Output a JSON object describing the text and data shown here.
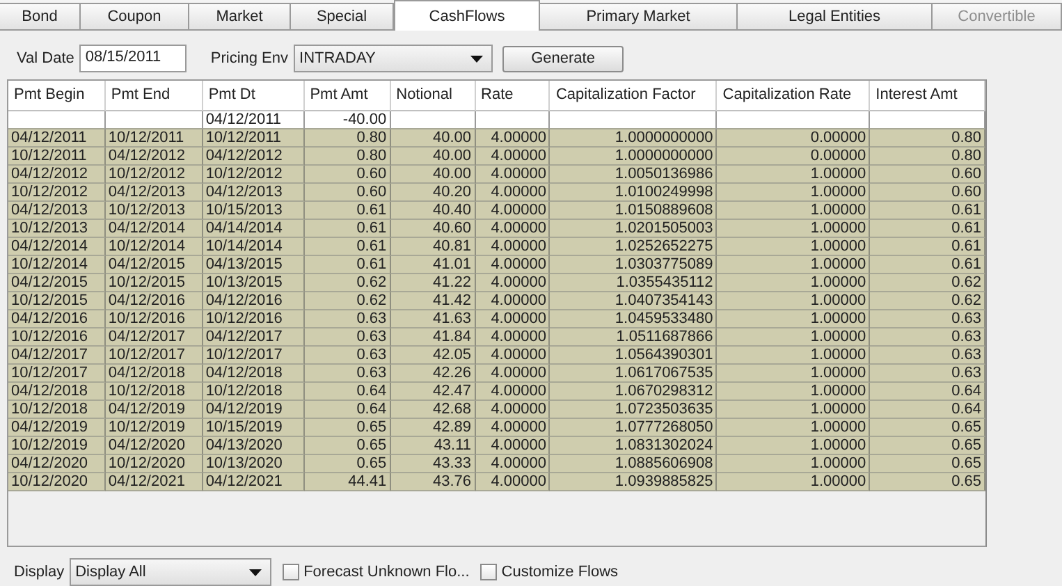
{
  "tabs": [
    {
      "label": "Bond",
      "selected": false,
      "disabled": false
    },
    {
      "label": "Coupon",
      "selected": false,
      "disabled": false
    },
    {
      "label": "Market",
      "selected": false,
      "disabled": false
    },
    {
      "label": "Special",
      "selected": false,
      "disabled": false
    },
    {
      "label": "CashFlows",
      "selected": true,
      "disabled": false
    },
    {
      "label": "Primary Market",
      "selected": false,
      "disabled": false
    },
    {
      "label": "Legal Entities",
      "selected": false,
      "disabled": false
    },
    {
      "label": "Convertible",
      "selected": false,
      "disabled": true
    }
  ],
  "toolbar": {
    "val_date": {
      "label": "Val Date",
      "value": "08/15/2011"
    },
    "pricing_env": {
      "label": "Pricing Env",
      "value": "INTRADAY"
    },
    "generate_button": "Generate"
  },
  "table": {
    "columns": [
      "Pmt Begin",
      "Pmt End",
      "Pmt Dt",
      "Pmt Amt",
      "Notional",
      "Rate",
      "Capitalization Factor",
      "Capitalization Rate",
      "Interest Amt"
    ],
    "rows": [
      {
        "kind": "initial",
        "cells": [
          null,
          null,
          "04/12/2011",
          "-40.00",
          null,
          null,
          null,
          null,
          null
        ]
      },
      {
        "kind": "flow",
        "cells": [
          "04/12/2011",
          "10/12/2011",
          "10/12/2011",
          "0.80",
          "40.00",
          "4.00000",
          "1.0000000000",
          "0.00000",
          "0.80"
        ]
      },
      {
        "kind": "flow",
        "cells": [
          "10/12/2011",
          "04/12/2012",
          "04/12/2012",
          "0.80",
          "40.00",
          "4.00000",
          "1.0000000000",
          "0.00000",
          "0.80"
        ]
      },
      {
        "kind": "flow",
        "cells": [
          "04/12/2012",
          "10/12/2012",
          "10/12/2012",
          "0.60",
          "40.00",
          "4.00000",
          "1.0050136986",
          "1.00000",
          "0.60"
        ]
      },
      {
        "kind": "flow",
        "cells": [
          "10/12/2012",
          "04/12/2013",
          "04/12/2013",
          "0.60",
          "40.20",
          "4.00000",
          "1.0100249998",
          "1.00000",
          "0.60"
        ]
      },
      {
        "kind": "flow",
        "cells": [
          "04/12/2013",
          "10/12/2013",
          "10/15/2013",
          "0.61",
          "40.40",
          "4.00000",
          "1.0150889608",
          "1.00000",
          "0.61"
        ]
      },
      {
        "kind": "flow",
        "cells": [
          "10/12/2013",
          "04/12/2014",
          "04/14/2014",
          "0.61",
          "40.60",
          "4.00000",
          "1.0201505003",
          "1.00000",
          "0.61"
        ]
      },
      {
        "kind": "flow",
        "cells": [
          "04/12/2014",
          "10/12/2014",
          "10/14/2014",
          "0.61",
          "40.81",
          "4.00000",
          "1.0252652275",
          "1.00000",
          "0.61"
        ]
      },
      {
        "kind": "flow",
        "cells": [
          "10/12/2014",
          "04/12/2015",
          "04/13/2015",
          "0.61",
          "41.01",
          "4.00000",
          "1.0303775089",
          "1.00000",
          "0.61"
        ]
      },
      {
        "kind": "flow",
        "cells": [
          "04/12/2015",
          "10/12/2015",
          "10/13/2015",
          "0.62",
          "41.22",
          "4.00000",
          "1.0355435112",
          "1.00000",
          "0.62"
        ]
      },
      {
        "kind": "flow",
        "cells": [
          "10/12/2015",
          "04/12/2016",
          "04/12/2016",
          "0.62",
          "41.42",
          "4.00000",
          "1.0407354143",
          "1.00000",
          "0.62"
        ]
      },
      {
        "kind": "flow",
        "cells": [
          "04/12/2016",
          "10/12/2016",
          "10/12/2016",
          "0.63",
          "41.63",
          "4.00000",
          "1.0459533480",
          "1.00000",
          "0.63"
        ]
      },
      {
        "kind": "flow",
        "cells": [
          "10/12/2016",
          "04/12/2017",
          "04/12/2017",
          "0.63",
          "41.84",
          "4.00000",
          "1.0511687866",
          "1.00000",
          "0.63"
        ]
      },
      {
        "kind": "flow",
        "cells": [
          "04/12/2017",
          "10/12/2017",
          "10/12/2017",
          "0.63",
          "42.05",
          "4.00000",
          "1.0564390301",
          "1.00000",
          "0.63"
        ]
      },
      {
        "kind": "flow",
        "cells": [
          "10/12/2017",
          "04/12/2018",
          "04/12/2018",
          "0.63",
          "42.26",
          "4.00000",
          "1.0617067535",
          "1.00000",
          "0.63"
        ]
      },
      {
        "kind": "flow",
        "cells": [
          "04/12/2018",
          "10/12/2018",
          "10/12/2018",
          "0.64",
          "42.47",
          "4.00000",
          "1.0670298312",
          "1.00000",
          "0.64"
        ]
      },
      {
        "kind": "flow",
        "cells": [
          "10/12/2018",
          "04/12/2019",
          "04/12/2019",
          "0.64",
          "42.68",
          "4.00000",
          "1.0723503635",
          "1.00000",
          "0.64"
        ]
      },
      {
        "kind": "flow",
        "cells": [
          "04/12/2019",
          "10/12/2019",
          "10/15/2019",
          "0.65",
          "42.89",
          "4.00000",
          "1.0777268050",
          "1.00000",
          "0.65"
        ]
      },
      {
        "kind": "flow",
        "cells": [
          "10/12/2019",
          "04/12/2020",
          "04/13/2020",
          "0.65",
          "43.11",
          "4.00000",
          "1.0831302024",
          "1.00000",
          "0.65"
        ]
      },
      {
        "kind": "flow",
        "cells": [
          "04/12/2020",
          "10/12/2020",
          "10/13/2020",
          "0.65",
          "43.33",
          "4.00000",
          "1.0885606908",
          "1.00000",
          "0.65"
        ]
      },
      {
        "kind": "flow",
        "cells": [
          "10/12/2020",
          "04/12/2021",
          "04/12/2021",
          "44.41",
          "43.76",
          "4.00000",
          "1.0939885825",
          "1.00000",
          "0.65"
        ]
      }
    ]
  },
  "footer": {
    "display": {
      "label": "Display",
      "value": "Display All"
    },
    "options": [
      {
        "label": "Forecast Unknown Flo...",
        "checked": false
      },
      {
        "label": "Customize Flows",
        "checked": false
      }
    ]
  }
}
